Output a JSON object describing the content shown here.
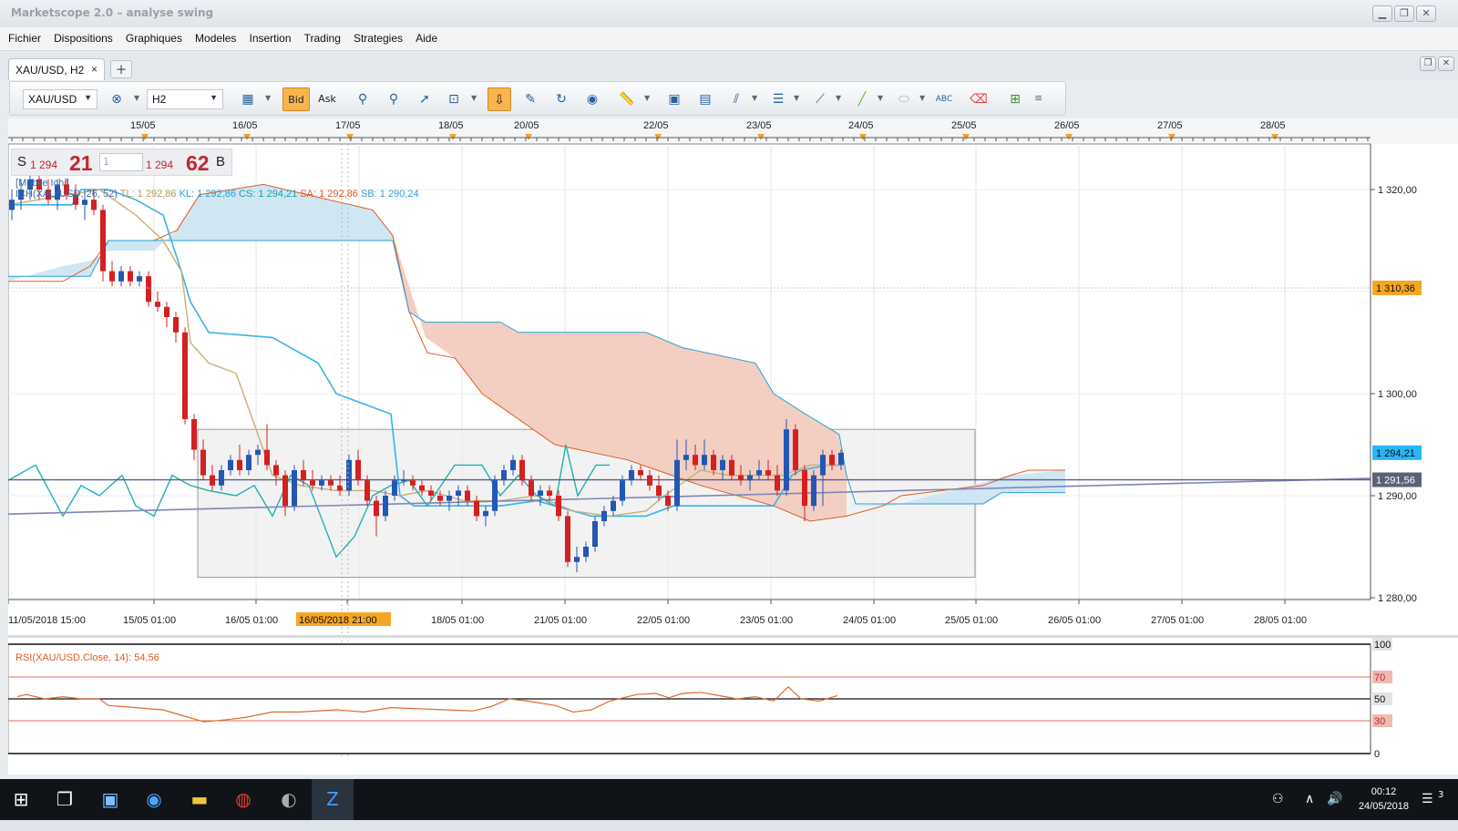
{
  "window": {
    "title": "Marketscope 2.0 – analyse swing"
  },
  "menu": [
    "Fichier",
    "Dispositions",
    "Graphiques",
    "Modeles",
    "Insertion",
    "Trading",
    "Strategies",
    "Aide"
  ],
  "tab": {
    "label": "XAU/USD, H2",
    "close": "×",
    "add": "+"
  },
  "toolbar": {
    "symbol": "XAU/USD",
    "timeframe": "H2",
    "bid": "Bid",
    "ask": "Ask"
  },
  "quote": {
    "sell_letter": "S",
    "sell_prefix": "1 294",
    "sell_big": "21",
    "quantity": "1",
    "buy_prefix": "1 294",
    "buy_big": "62",
    "buy_letter": "B"
  },
  "indicator": {
    "name": "[Mobile Ichi]",
    "header": "ICH(XAU/USD, 26, 52)",
    "tl": "TL: 1 292,86",
    "kl": "KL: 1 292,86",
    "cs": "CS: 1 294,21",
    "sa": "SA: 1 292,86",
    "sb": "SB: 1 290,24"
  },
  "rsi": {
    "label": "RSI(XAU/USD.Close, 14): 54,56",
    "levels": [
      "100",
      "70",
      "50",
      "30",
      "0"
    ]
  },
  "top_dates": [
    "15/05",
    "16/05",
    "17/05",
    "18/05",
    "20/05",
    "22/05",
    "23/05",
    "24/05",
    "25/05",
    "26/05",
    "27/05",
    "28/05"
  ],
  "bottom_dates": [
    "11/05/2018 15:00",
    "15/05 01:00",
    "16/05 01:00",
    "16/05/2018 21:00",
    "18/05 01:00",
    "21/05 01:00",
    "22/05 01:00",
    "23/05 01:00",
    "24/05 01:00",
    "25/05 01:00",
    "26/05 01:00",
    "27/05 01:00",
    "28/05 01:00"
  ],
  "price_ticks": [
    "1 320,00",
    "1 300,00",
    "1 290,00",
    "1 280,00"
  ],
  "price_badges": {
    "orange": "1 310,36",
    "blue": "1 294,21",
    "grey": "1 291,56"
  },
  "colors": {
    "bull": "#2457b3",
    "bear": "#d42020",
    "kijun": "#3ab3e8",
    "tenkan": "#c8b07a",
    "chikou": "#20b0b0",
    "cloud_bull": "#cfe6f3",
    "cloud_bear": "#f2cfc2",
    "rsi": "#e06a2a"
  },
  "taskbar": {
    "time": "00:12",
    "date": "24/05/2018",
    "notif": "3"
  }
}
